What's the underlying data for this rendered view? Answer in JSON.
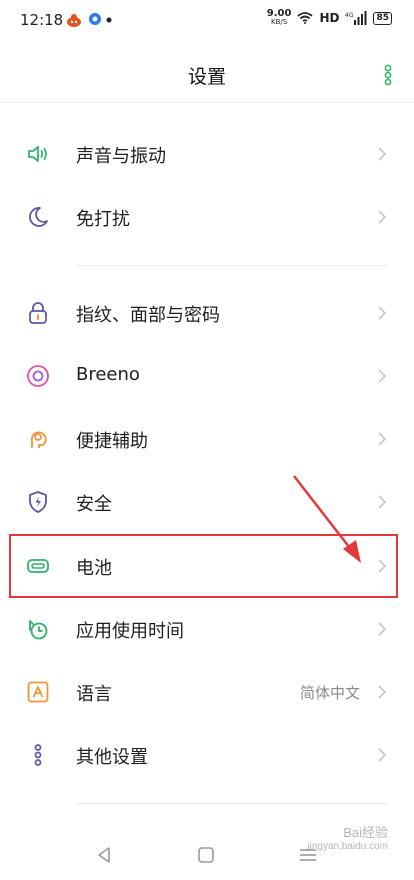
{
  "status_bar": {
    "time": "12:18",
    "net_speed_value": "9.00",
    "net_speed_unit": "KB/S",
    "network_type": "HD",
    "signal_label": "4G",
    "battery_level": "85"
  },
  "header": {
    "title": "设置"
  },
  "settings": {
    "items": [
      {
        "label": "声音与振动",
        "icon": "speaker-vibrate-icon"
      },
      {
        "label": "免打扰",
        "icon": "moon-icon"
      },
      {
        "label": "指纹、面部与密码",
        "icon": "lock-icon"
      },
      {
        "label": "Breeno",
        "icon": "breeno-icon"
      },
      {
        "label": "便捷辅助",
        "icon": "assist-hand-icon"
      },
      {
        "label": "安全",
        "icon": "shield-icon"
      },
      {
        "label": "电池",
        "icon": "battery-icon"
      },
      {
        "label": "应用使用时间",
        "icon": "alarm-clock-icon"
      },
      {
        "label": "语言",
        "icon": "language-icon",
        "value": "简体中文"
      },
      {
        "label": "其他设置",
        "icon": "more-settings-icon"
      }
    ]
  },
  "colors": {
    "accent_green": "#2fb36d",
    "icon_purple": "#5a57a5",
    "icon_orange": "#f2953a",
    "icon_pink": "#d557a5",
    "annotation_red": "#e03a3a"
  },
  "watermark": {
    "line1": "Bai",
    "line2": "经验",
    "line3": "jingyan.baidu.com"
  }
}
